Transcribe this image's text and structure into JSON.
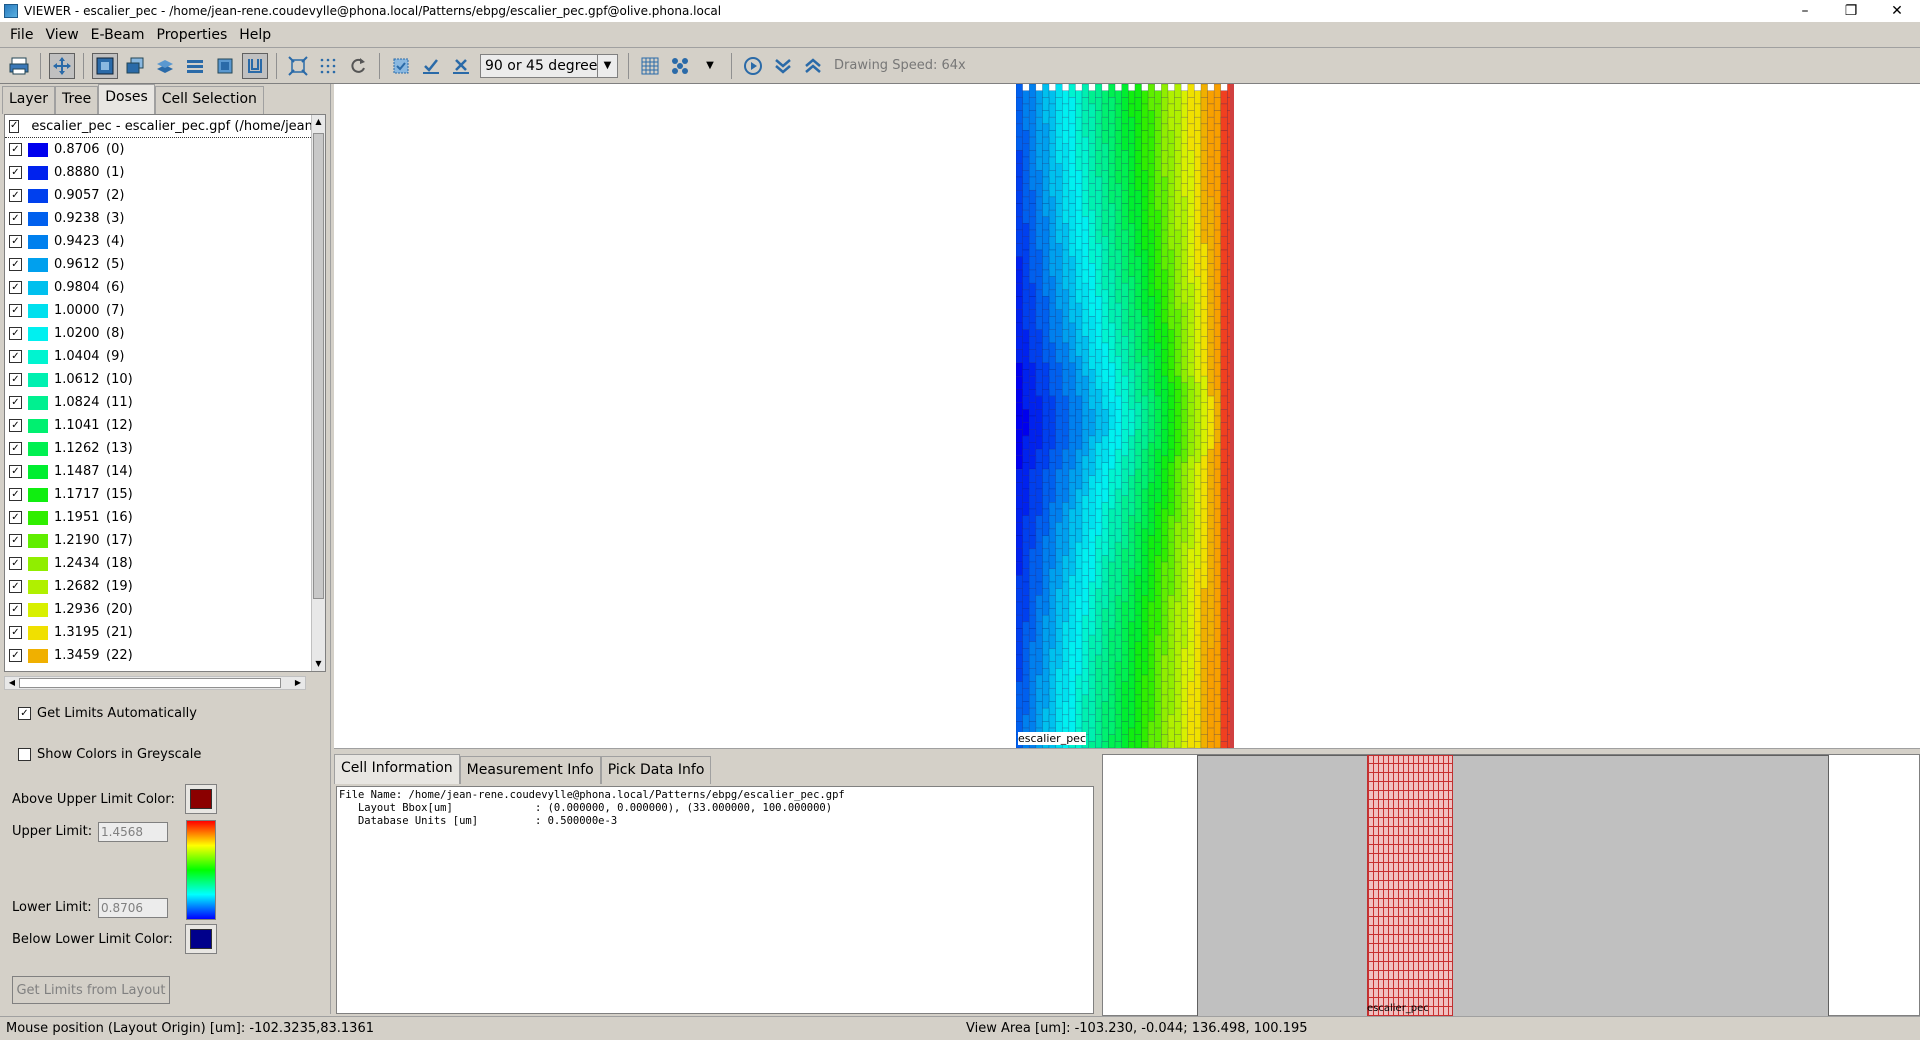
{
  "window": {
    "title": "VIEWER - escalier_pec - /home/jean-rene.coudevylle@phona.local/Patterns/ebpg/escalier_pec.gpf@olive.phona.local",
    "controls": [
      "–",
      "❐",
      "✕"
    ]
  },
  "menu": {
    "items": [
      {
        "label": "File"
      },
      {
        "label": "View"
      },
      {
        "label": "E-Beam"
      },
      {
        "label": "Properties"
      },
      {
        "label": "Help"
      }
    ]
  },
  "toolbar": {
    "angle_mode": "90 or 45 degree",
    "drawing_speed": "Drawing Speed: 64x"
  },
  "left_tabs": [
    {
      "label": "Layer"
    },
    {
      "label": "Tree"
    },
    {
      "label": "Doses"
    },
    {
      "label": "Cell Selection"
    }
  ],
  "dose_tree": {
    "header": "escalier_pec - escalier_pec.gpf (/home/jean-rene.coudevylle@phona.local/Patterns/ebpg/escalier_pec.gpf)",
    "rows": [
      {
        "value": "0.8706",
        "index": "(0)",
        "color": "#0000ee"
      },
      {
        "value": "0.8880",
        "index": "(1)",
        "color": "#0022ee"
      },
      {
        "value": "0.9057",
        "index": "(2)",
        "color": "#0040ee"
      },
      {
        "value": "0.9238",
        "index": "(3)",
        "color": "#0060ee"
      },
      {
        "value": "0.9423",
        "index": "(4)",
        "color": "#0080ee"
      },
      {
        "value": "0.9612",
        "index": "(5)",
        "color": "#00a0ee"
      },
      {
        "value": "0.9804",
        "index": "(6)",
        "color": "#00c0ee"
      },
      {
        "value": "1.0000",
        "index": "(7)",
        "color": "#00e0ee"
      },
      {
        "value": "1.0200",
        "index": "(8)",
        "color": "#00f0f0"
      },
      {
        "value": "1.0404",
        "index": "(9)",
        "color": "#00f4d0"
      },
      {
        "value": "1.0612",
        "index": "(10)",
        "color": "#00f0b0"
      },
      {
        "value": "1.0824",
        "index": "(11)",
        "color": "#00f090"
      },
      {
        "value": "1.1041",
        "index": "(12)",
        "color": "#00f070"
      },
      {
        "value": "1.1262",
        "index": "(13)",
        "color": "#00f050"
      },
      {
        "value": "1.1487",
        "index": "(14)",
        "color": "#00ee30"
      },
      {
        "value": "1.1717",
        "index": "(15)",
        "color": "#10ee10"
      },
      {
        "value": "1.1951",
        "index": "(16)",
        "color": "#30ee00"
      },
      {
        "value": "1.2190",
        "index": "(17)",
        "color": "#60ee00"
      },
      {
        "value": "1.2434",
        "index": "(18)",
        "color": "#90ee00"
      },
      {
        "value": "1.2682",
        "index": "(19)",
        "color": "#b0f000"
      },
      {
        "value": "1.2936",
        "index": "(20)",
        "color": "#d8f000"
      },
      {
        "value": "1.3195",
        "index": "(21)",
        "color": "#f0e000"
      },
      {
        "value": "1.3459",
        "index": "(22)",
        "color": "#f0b000"
      }
    ]
  },
  "options": {
    "get_limits_auto": "Get Limits Automatically",
    "greyscale": "Show Colors in Greyscale",
    "above_upper_label": "Above Upper Limit Color:",
    "upper_label": "Upper Limit:",
    "upper_value": "1.4568",
    "lower_label": "Lower Limit:",
    "lower_value": "0.8706",
    "below_lower_label": "Below Lower Limit Color:",
    "get_limits_button": "Get Limits from Layout",
    "above_color": "#8b0000",
    "below_color": "#00008b"
  },
  "canvas": {
    "cell_label": "escalier_pec"
  },
  "info_tabs": [
    {
      "label": "Cell Information"
    },
    {
      "label": "Measurement Info"
    },
    {
      "label": "Pick Data Info"
    }
  ],
  "cell_info": {
    "text": "File Name: /home/jean-rene.coudevylle@phona.local/Patterns/ebpg/escalier_pec.gpf\n   Layout Bbox[um]             : (0.000000, 0.000000), (33.000000, 100.000000)\n   Database Units [um]         : 0.500000e-3"
  },
  "overview": {
    "cell_label": "escalier_pec"
  },
  "status": {
    "mouse_position": "Mouse position (Layout Origin) [um]: -102.3235,83.1361",
    "view_area": "View Area [um]: -103.230, -0.044; 136.498, 100.195"
  }
}
